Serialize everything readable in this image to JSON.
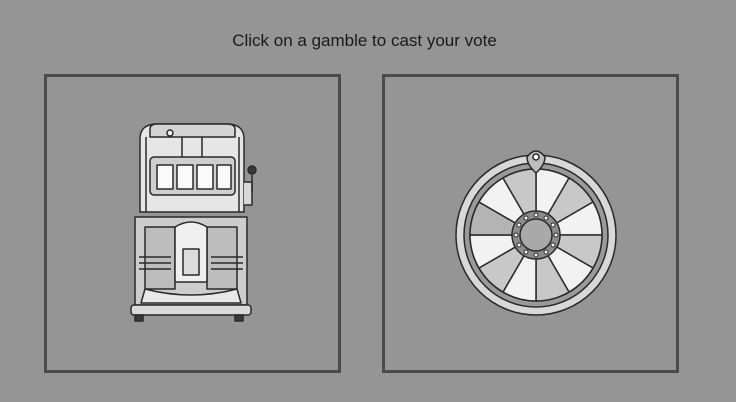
{
  "prompt": {
    "text": "Click on a gamble to cast your vote"
  },
  "choices": [
    {
      "icon": "slot-machine-icon"
    },
    {
      "icon": "prize-wheel-icon"
    }
  ],
  "colors": {
    "background": "#959595",
    "border": "#4b4b4b",
    "text": "#1a1a1a"
  }
}
